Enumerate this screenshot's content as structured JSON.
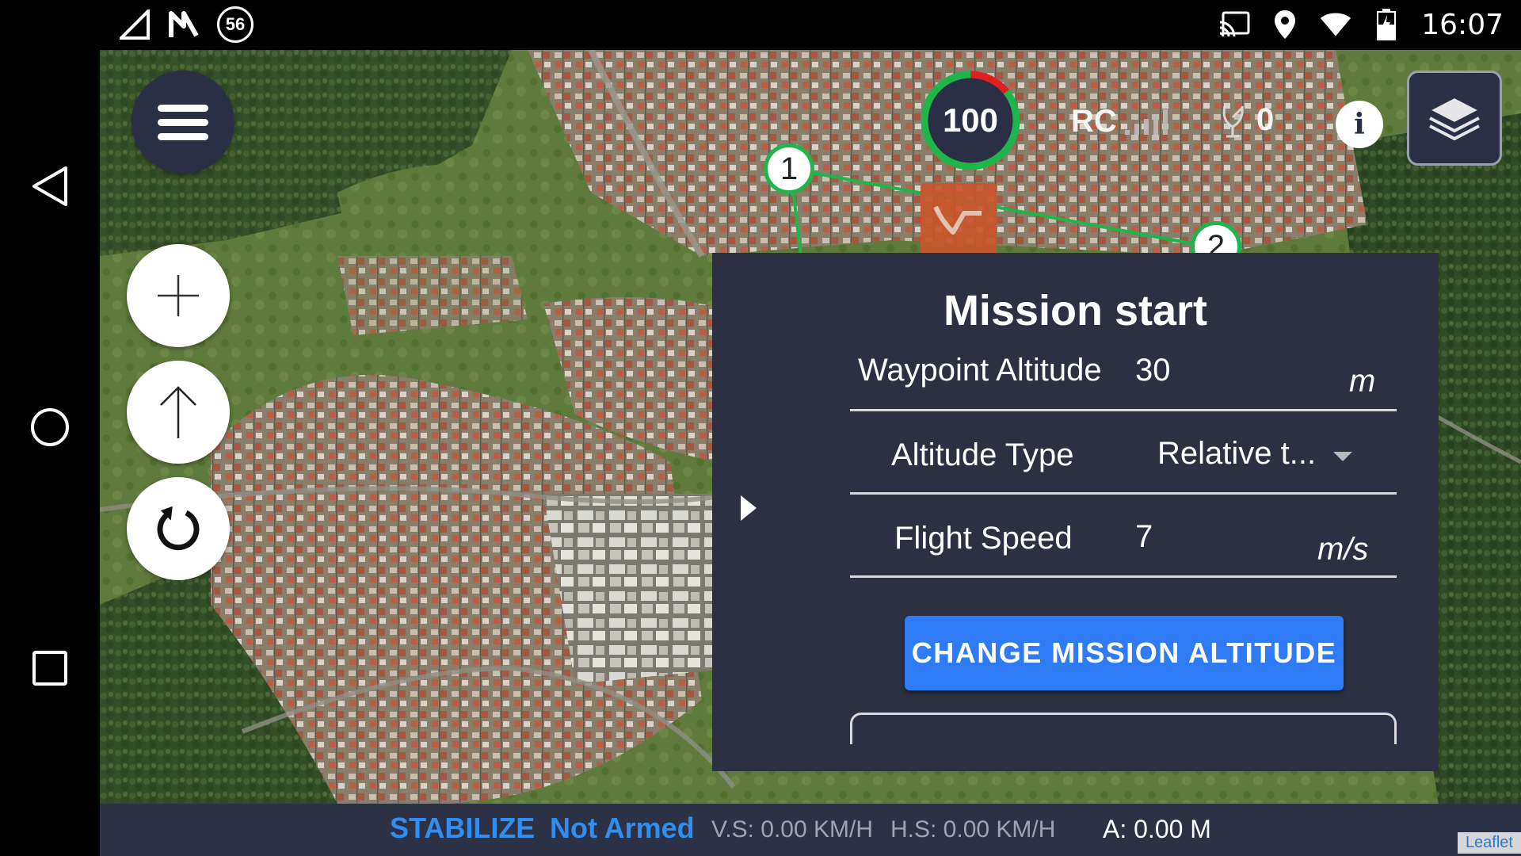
{
  "statusbar": {
    "left_icons": [
      "signal-icon",
      "nfc-icon",
      "notification-count-icon"
    ],
    "notification_count": "56",
    "right_icons": [
      "cast-icon",
      "location-icon",
      "wifi-icon",
      "battery-icon"
    ],
    "time": "16:07"
  },
  "navbar": {
    "buttons": [
      "back-icon",
      "home-icon",
      "recents-icon"
    ]
  },
  "map": {
    "battery_percent": "100",
    "battery_fraction": 0.86,
    "rc_label": "RC",
    "satellite_count": "0",
    "waypoints": [
      "1",
      "2"
    ],
    "attribution": "Leaflet",
    "colors": {
      "route": "#1fb54a",
      "battery_ok": "#1fb54a",
      "battery_low": "#e02020"
    }
  },
  "panel": {
    "title": "Mission start",
    "waypoint_altitude": {
      "label": "Waypoint Altitude",
      "value": "30",
      "unit": "m"
    },
    "altitude_type": {
      "label": "Altitude Type",
      "value": "Relative t..."
    },
    "flight_speed": {
      "label": "Flight Speed",
      "value": "7",
      "unit": "m/s"
    },
    "action_button": "CHANGE MISSION ALTITUDE"
  },
  "bottombar": {
    "mode": "STABILIZE",
    "armed": "Not Armed",
    "vs": "V.S: 0.00 KM/H",
    "hs": "H.S: 0.00 KM/H",
    "alt": "A: 0.00 M"
  }
}
